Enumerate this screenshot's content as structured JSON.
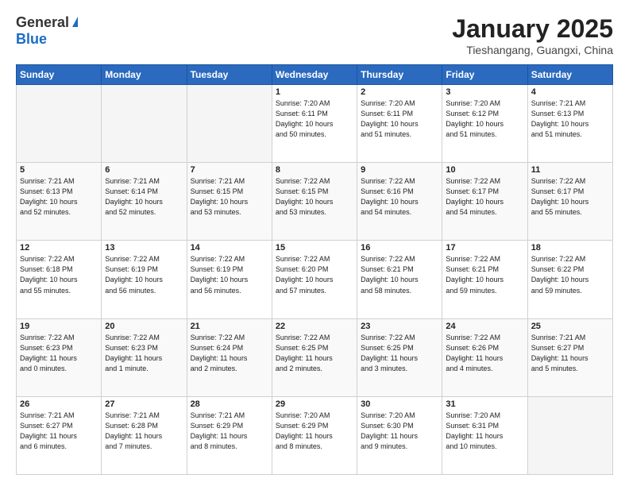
{
  "header": {
    "logo_general": "General",
    "logo_blue": "Blue",
    "title": "January 2025",
    "subtitle": "Tieshangang, Guangxi, China"
  },
  "days_of_week": [
    "Sunday",
    "Monday",
    "Tuesday",
    "Wednesday",
    "Thursday",
    "Friday",
    "Saturday"
  ],
  "weeks": [
    [
      {
        "num": "",
        "info": ""
      },
      {
        "num": "",
        "info": ""
      },
      {
        "num": "",
        "info": ""
      },
      {
        "num": "1",
        "info": "Sunrise: 7:20 AM\nSunset: 6:11 PM\nDaylight: 10 hours\nand 50 minutes."
      },
      {
        "num": "2",
        "info": "Sunrise: 7:20 AM\nSunset: 6:11 PM\nDaylight: 10 hours\nand 51 minutes."
      },
      {
        "num": "3",
        "info": "Sunrise: 7:20 AM\nSunset: 6:12 PM\nDaylight: 10 hours\nand 51 minutes."
      },
      {
        "num": "4",
        "info": "Sunrise: 7:21 AM\nSunset: 6:13 PM\nDaylight: 10 hours\nand 51 minutes."
      }
    ],
    [
      {
        "num": "5",
        "info": "Sunrise: 7:21 AM\nSunset: 6:13 PM\nDaylight: 10 hours\nand 52 minutes."
      },
      {
        "num": "6",
        "info": "Sunrise: 7:21 AM\nSunset: 6:14 PM\nDaylight: 10 hours\nand 52 minutes."
      },
      {
        "num": "7",
        "info": "Sunrise: 7:21 AM\nSunset: 6:15 PM\nDaylight: 10 hours\nand 53 minutes."
      },
      {
        "num": "8",
        "info": "Sunrise: 7:22 AM\nSunset: 6:15 PM\nDaylight: 10 hours\nand 53 minutes."
      },
      {
        "num": "9",
        "info": "Sunrise: 7:22 AM\nSunset: 6:16 PM\nDaylight: 10 hours\nand 54 minutes."
      },
      {
        "num": "10",
        "info": "Sunrise: 7:22 AM\nSunset: 6:17 PM\nDaylight: 10 hours\nand 54 minutes."
      },
      {
        "num": "11",
        "info": "Sunrise: 7:22 AM\nSunset: 6:17 PM\nDaylight: 10 hours\nand 55 minutes."
      }
    ],
    [
      {
        "num": "12",
        "info": "Sunrise: 7:22 AM\nSunset: 6:18 PM\nDaylight: 10 hours\nand 55 minutes."
      },
      {
        "num": "13",
        "info": "Sunrise: 7:22 AM\nSunset: 6:19 PM\nDaylight: 10 hours\nand 56 minutes."
      },
      {
        "num": "14",
        "info": "Sunrise: 7:22 AM\nSunset: 6:19 PM\nDaylight: 10 hours\nand 56 minutes."
      },
      {
        "num": "15",
        "info": "Sunrise: 7:22 AM\nSunset: 6:20 PM\nDaylight: 10 hours\nand 57 minutes."
      },
      {
        "num": "16",
        "info": "Sunrise: 7:22 AM\nSunset: 6:21 PM\nDaylight: 10 hours\nand 58 minutes."
      },
      {
        "num": "17",
        "info": "Sunrise: 7:22 AM\nSunset: 6:21 PM\nDaylight: 10 hours\nand 59 minutes."
      },
      {
        "num": "18",
        "info": "Sunrise: 7:22 AM\nSunset: 6:22 PM\nDaylight: 10 hours\nand 59 minutes."
      }
    ],
    [
      {
        "num": "19",
        "info": "Sunrise: 7:22 AM\nSunset: 6:23 PM\nDaylight: 11 hours\nand 0 minutes."
      },
      {
        "num": "20",
        "info": "Sunrise: 7:22 AM\nSunset: 6:23 PM\nDaylight: 11 hours\nand 1 minute."
      },
      {
        "num": "21",
        "info": "Sunrise: 7:22 AM\nSunset: 6:24 PM\nDaylight: 11 hours\nand 2 minutes."
      },
      {
        "num": "22",
        "info": "Sunrise: 7:22 AM\nSunset: 6:25 PM\nDaylight: 11 hours\nand 2 minutes."
      },
      {
        "num": "23",
        "info": "Sunrise: 7:22 AM\nSunset: 6:25 PM\nDaylight: 11 hours\nand 3 minutes."
      },
      {
        "num": "24",
        "info": "Sunrise: 7:22 AM\nSunset: 6:26 PM\nDaylight: 11 hours\nand 4 minutes."
      },
      {
        "num": "25",
        "info": "Sunrise: 7:21 AM\nSunset: 6:27 PM\nDaylight: 11 hours\nand 5 minutes."
      }
    ],
    [
      {
        "num": "26",
        "info": "Sunrise: 7:21 AM\nSunset: 6:27 PM\nDaylight: 11 hours\nand 6 minutes."
      },
      {
        "num": "27",
        "info": "Sunrise: 7:21 AM\nSunset: 6:28 PM\nDaylight: 11 hours\nand 7 minutes."
      },
      {
        "num": "28",
        "info": "Sunrise: 7:21 AM\nSunset: 6:29 PM\nDaylight: 11 hours\nand 8 minutes."
      },
      {
        "num": "29",
        "info": "Sunrise: 7:20 AM\nSunset: 6:29 PM\nDaylight: 11 hours\nand 8 minutes."
      },
      {
        "num": "30",
        "info": "Sunrise: 7:20 AM\nSunset: 6:30 PM\nDaylight: 11 hours\nand 9 minutes."
      },
      {
        "num": "31",
        "info": "Sunrise: 7:20 AM\nSunset: 6:31 PM\nDaylight: 11 hours\nand 10 minutes."
      },
      {
        "num": "",
        "info": ""
      }
    ]
  ]
}
